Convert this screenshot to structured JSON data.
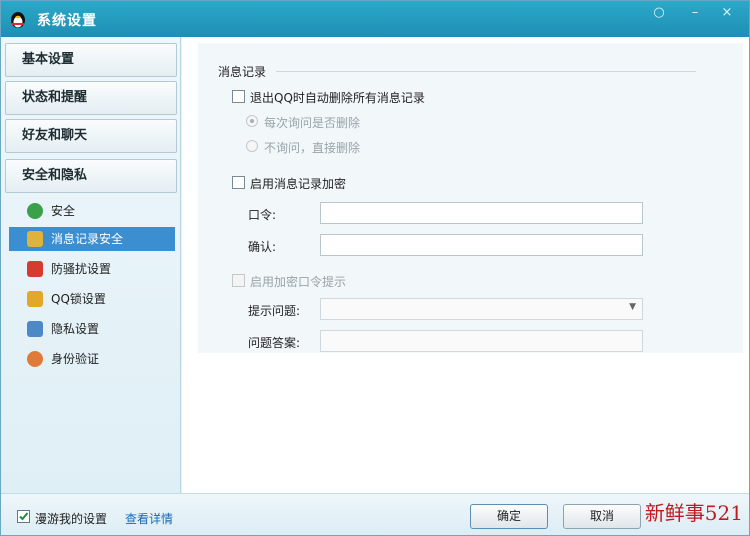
{
  "window": {
    "title": "系统设置",
    "minimize": "–",
    "close": "×",
    "menu": "○"
  },
  "sidebar": {
    "categories": [
      {
        "label": "基本设置"
      },
      {
        "label": "状态和提醒"
      },
      {
        "label": "好友和聊天"
      },
      {
        "label": "安全和隐私"
      }
    ],
    "items": [
      {
        "label": "安全",
        "icon": "shield-icon",
        "color": "#3aa04a"
      },
      {
        "label": "消息记录安全",
        "icon": "folder-icon",
        "color": "#e0b23a",
        "active": true
      },
      {
        "label": "防骚扰设置",
        "icon": "lock-icon",
        "color": "#d63b2f"
      },
      {
        "label": "QQ锁设置",
        "icon": "padlock-icon",
        "color": "#e3a82a"
      },
      {
        "label": "隐私设置",
        "icon": "privacy-icon",
        "color": "#4d88c7"
      },
      {
        "label": "身份验证",
        "icon": "user-icon",
        "color": "#e07a3a"
      }
    ]
  },
  "content": {
    "section_title": "消息记录",
    "auto_delete": {
      "label": "退出QQ时自动删除所有消息记录",
      "checked": false
    },
    "radio_ask": "每次询问是否删除",
    "radio_direct": "不询问，直接删除",
    "encrypt": {
      "label": "启用消息记录加密",
      "checked": false
    },
    "password_label": "口令:",
    "confirm_label": "确认:",
    "hint_toggle": "启用加密口令提示",
    "hint_question_label": "提示问题:",
    "hint_answer_label": "问题答案:"
  },
  "footer": {
    "roaming_label": "漫游我的设置",
    "roaming_checked": true,
    "details_link": "查看详情",
    "ok_button": "确定",
    "cancel_button": "取消"
  },
  "watermark": "新鲜事521"
}
